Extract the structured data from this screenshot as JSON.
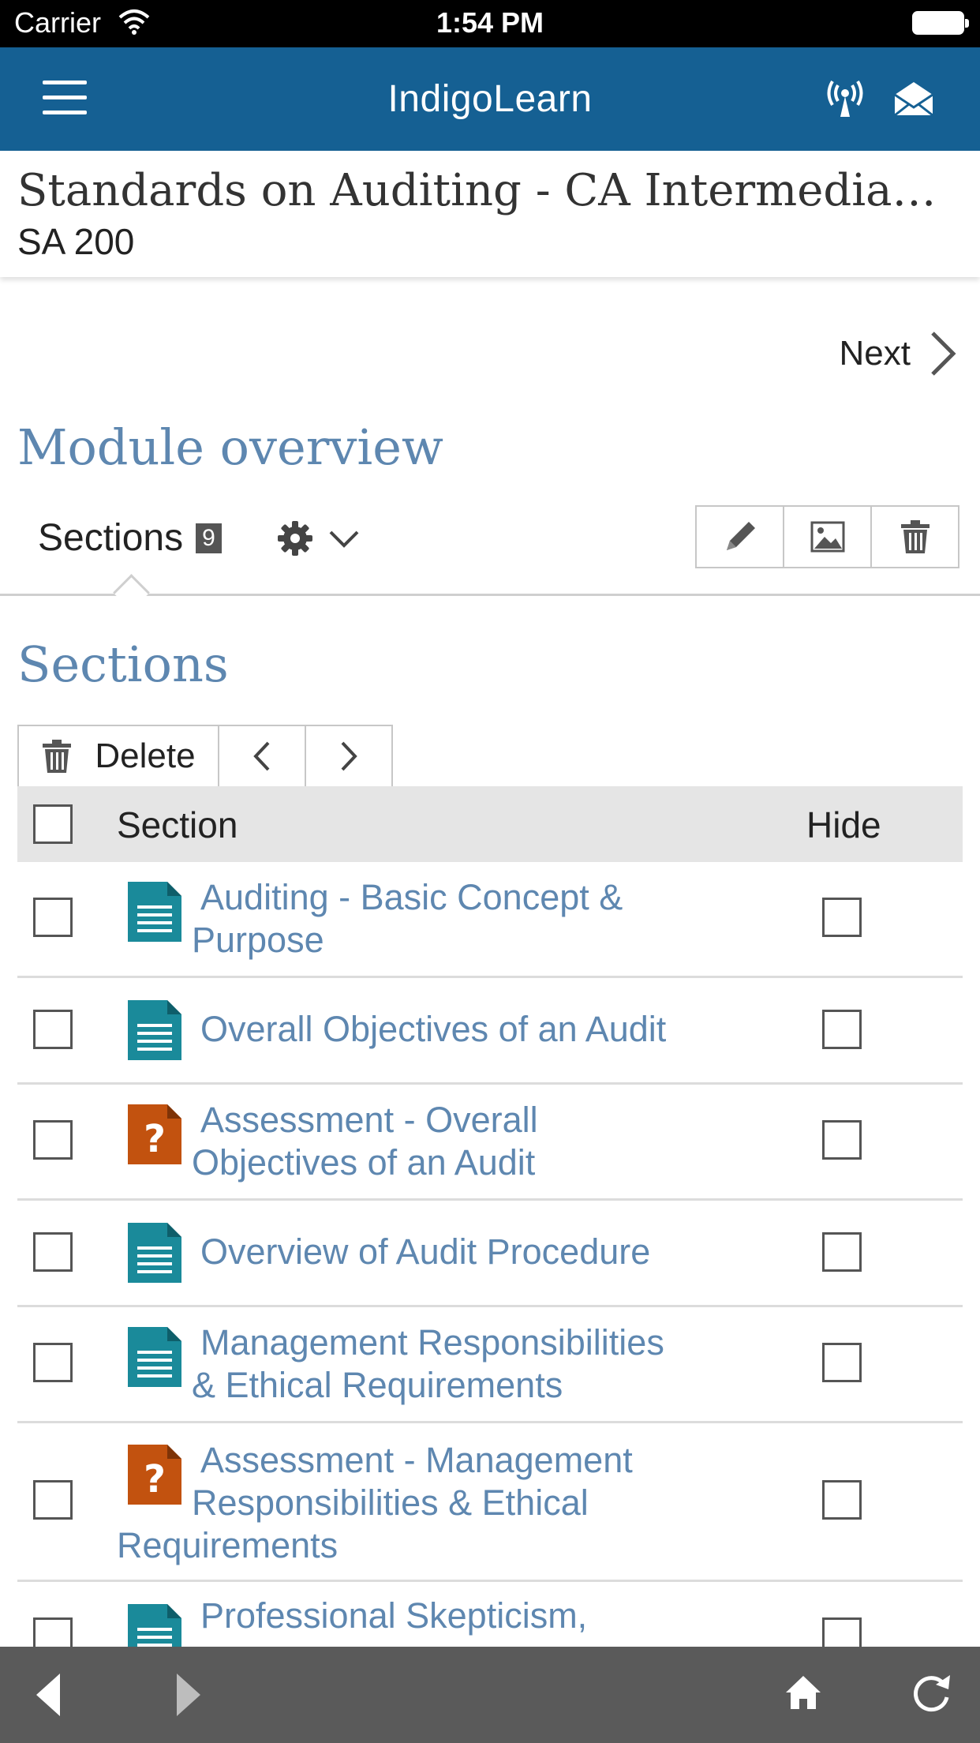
{
  "status_bar": {
    "carrier": "Carrier",
    "time": "1:54 PM"
  },
  "app_bar": {
    "title": "IndigoLearn"
  },
  "course": {
    "title": "Standards on Auditing - CA Intermedia…",
    "subtitle": "SA 200"
  },
  "nav": {
    "next_label": "Next"
  },
  "module": {
    "heading": "Module overview",
    "tab_label": "Sections",
    "section_count": "9"
  },
  "sections_panel": {
    "heading": "Sections",
    "delete_label": "Delete",
    "columns": {
      "section": "Section",
      "hide": "Hide"
    },
    "rows": [
      {
        "line1": "Auditing - Basic Concept &",
        "line2": "Purpose",
        "line3": "",
        "type": "document"
      },
      {
        "line1": "Overall Objectives of an Audit",
        "line2": "",
        "line3": "",
        "type": "document"
      },
      {
        "line1": "Assessment - Overall",
        "line2": "Objectives of an Audit",
        "line3": "",
        "type": "quiz"
      },
      {
        "line1": "Overview of Audit Procedure",
        "line2": "",
        "line3": "",
        "type": "document"
      },
      {
        "line1": "Management Responsibilities",
        "line2": "& Ethical Requirements",
        "line3": "",
        "type": "document"
      },
      {
        "line1": "Assessment - Management",
        "line2": "Responsibilities & Ethical",
        "line3": "Requirements",
        "type": "quiz"
      },
      {
        "line1": "Professional Skepticism,",
        "line2": "",
        "line3": "",
        "type": "document"
      }
    ]
  },
  "colors": {
    "app_bar": "#156093",
    "heading": "#5e87b0",
    "doc_icon": "#1a8a9a",
    "quiz_icon": "#c2520f",
    "bottom_bar": "#5a5a5a"
  },
  "icons": [
    "menu-icon",
    "wifi-icon",
    "broadcast-icon",
    "mail-icon",
    "chevron-right-icon",
    "gear-icon",
    "chevron-down-icon",
    "pencil-icon",
    "image-icon",
    "trash-icon",
    "document-icon",
    "question-icon",
    "back-icon",
    "forward-icon",
    "home-icon",
    "refresh-icon"
  ]
}
